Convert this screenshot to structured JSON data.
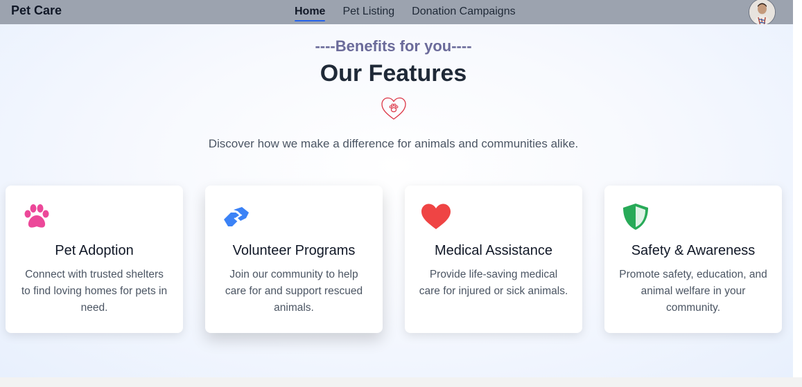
{
  "navbar": {
    "brand": "Pet Care",
    "links": [
      {
        "label": "Home",
        "active": true
      },
      {
        "label": "Pet Listing",
        "active": false
      },
      {
        "label": "Donation Campaigns",
        "active": false
      }
    ],
    "avatar_icon": "user-avatar"
  },
  "features": {
    "subtitle": "----Benefits for you----",
    "title": "Our Features",
    "title_icon": "paw-heart-icon",
    "description": "Discover how we make a difference for animals and communities alike.",
    "cards": [
      {
        "icon": "paw-icon",
        "icon_color": "#ec4899",
        "title": "Pet Adoption",
        "text": "Connect with trusted shelters to find loving homes for pets in need."
      },
      {
        "icon": "handshake-icon",
        "icon_color": "#3b82f6",
        "title": "Volunteer Programs",
        "text": "Join our community to help care for and support rescued animals."
      },
      {
        "icon": "heart-icon",
        "icon_color": "#ef4444",
        "title": "Medical Assistance",
        "text": "Provide life-saving medical care for injured or sick animals."
      },
      {
        "icon": "shield-icon",
        "icon_color": "#16a34a",
        "title": "Safety & Awareness",
        "text": "Promote safety, education, and animal welfare in your community."
      }
    ]
  },
  "colors": {
    "navbar_bg": "#9ca3af",
    "active_underline": "#2563eb",
    "subtitle": "#6b6b9a",
    "title": "#1f2937"
  }
}
